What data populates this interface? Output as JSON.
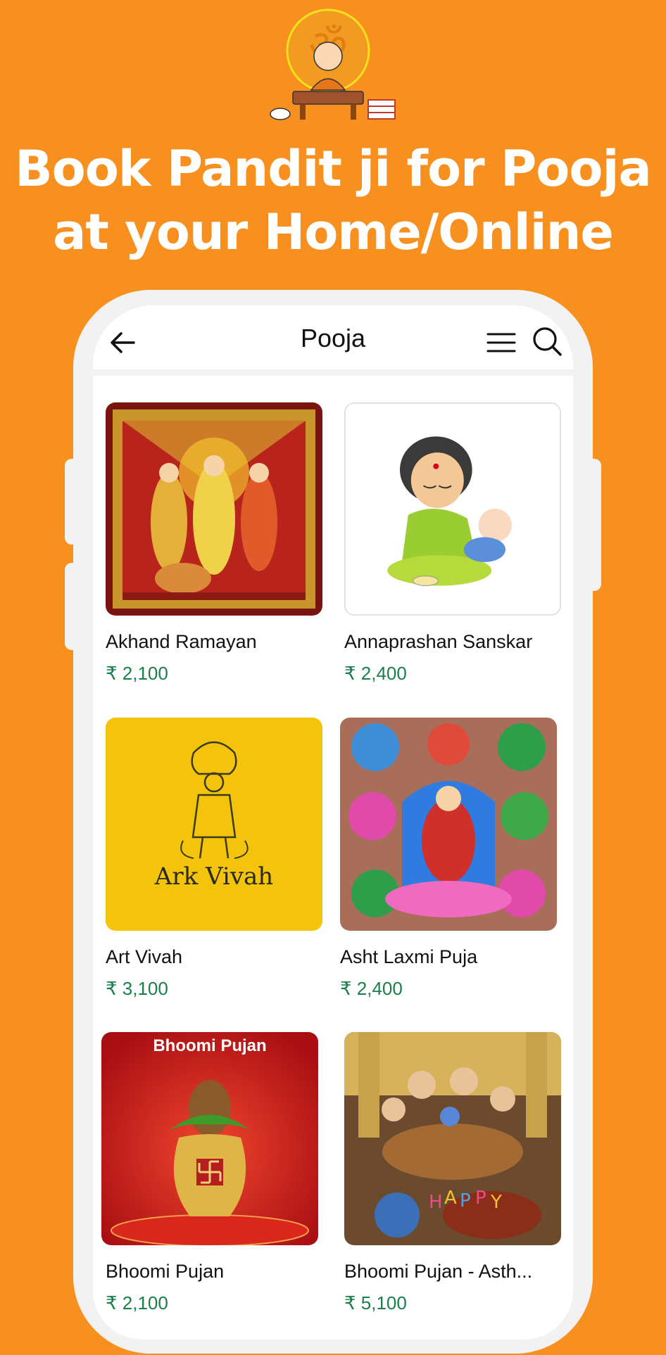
{
  "headline": {
    "line1": "Book Pandit ji for Pooja",
    "line2": "at your Home/Online"
  },
  "header": {
    "title": "Pooja",
    "icons": [
      "back-arrow-icon",
      "menu-icon",
      "search-icon"
    ]
  },
  "colors": {
    "background": "#F7901E",
    "price": "#1B7F4B",
    "phone_frame": "#F2F2F2"
  },
  "poojas": [
    {
      "name": "Akhand Ramayan",
      "price": "₹ 2,100"
    },
    {
      "name": "Annaprashan Sanskar",
      "price": "₹ 2,400"
    },
    {
      "name": "Art Vivah",
      "price": "₹ 3,100",
      "image_text": "Ark Vivah"
    },
    {
      "name": "Asht Laxmi Puja",
      "price": "₹ 2,400"
    },
    {
      "name": "Bhoomi Pujan",
      "price": "₹ 2,100",
      "image_text": "Bhoomi Pujan"
    },
    {
      "name": "Bhoomi Pujan - Asth...",
      "price": "₹ 5,100"
    }
  ]
}
